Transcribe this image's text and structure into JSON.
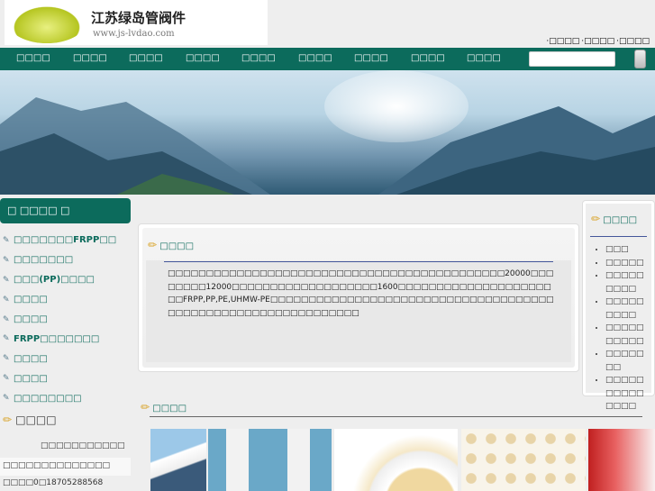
{
  "header": {
    "logo_title": "江苏绿岛管阀件",
    "logo_url": "www.js-lvdao.com",
    "top_links": [
      "·□□□□",
      "·□□□□",
      "·□□□□"
    ]
  },
  "nav": {
    "items": [
      "□□□□",
      "□□□□",
      "□□□□",
      "□□□□",
      "□□□□",
      "□□□□",
      "□□□□",
      "□□□□",
      "□□□□"
    ],
    "search_placeholder": ""
  },
  "sidebar": {
    "title": "□ □□□□ □",
    "items": [
      "□□□□□□□FRPP□□",
      "□□□□□□□",
      "□□□(PP)□□□□",
      "□□□□",
      "□□□□",
      "FRPP□□□□□□□",
      "□□□□",
      "□□□□",
      "□□□□□□□□"
    ],
    "contact_title": "□□□□",
    "contact_company": "□□□□□□□□□□□",
    "contact_address": "□□□□□□□□□□□□□□",
    "contact_phone": "□□□□0□18705288568"
  },
  "about": {
    "title": "□□□□",
    "text": "□□□□□□□□□□□□□□□□□□□□□□□□□□□□□□□□□□□□□□□□□□□□20000□□□□□□□□12000□□□□□□□□□□□□□□□□□□□1600□□□□□□□□□□□□□□□□□□□□□□FRPP,PP,PE,UHMW-PE□□□□□□□□□□□□□□□□□□□□□□□□□□□□□□□□□□□□□□□□□□□□□□□□□□□□□□□□□□□□□□"
  },
  "news": {
    "title": "□□□□",
    "items": [
      "□□□",
      "□□□□□",
      "□□□□□□□□□",
      "□□□□□□□□□",
      "□□□□□□□□□□",
      "□□□□□□□",
      "□□□□□□□□□□□□□□"
    ]
  },
  "products": {
    "title": "□□□□"
  }
}
